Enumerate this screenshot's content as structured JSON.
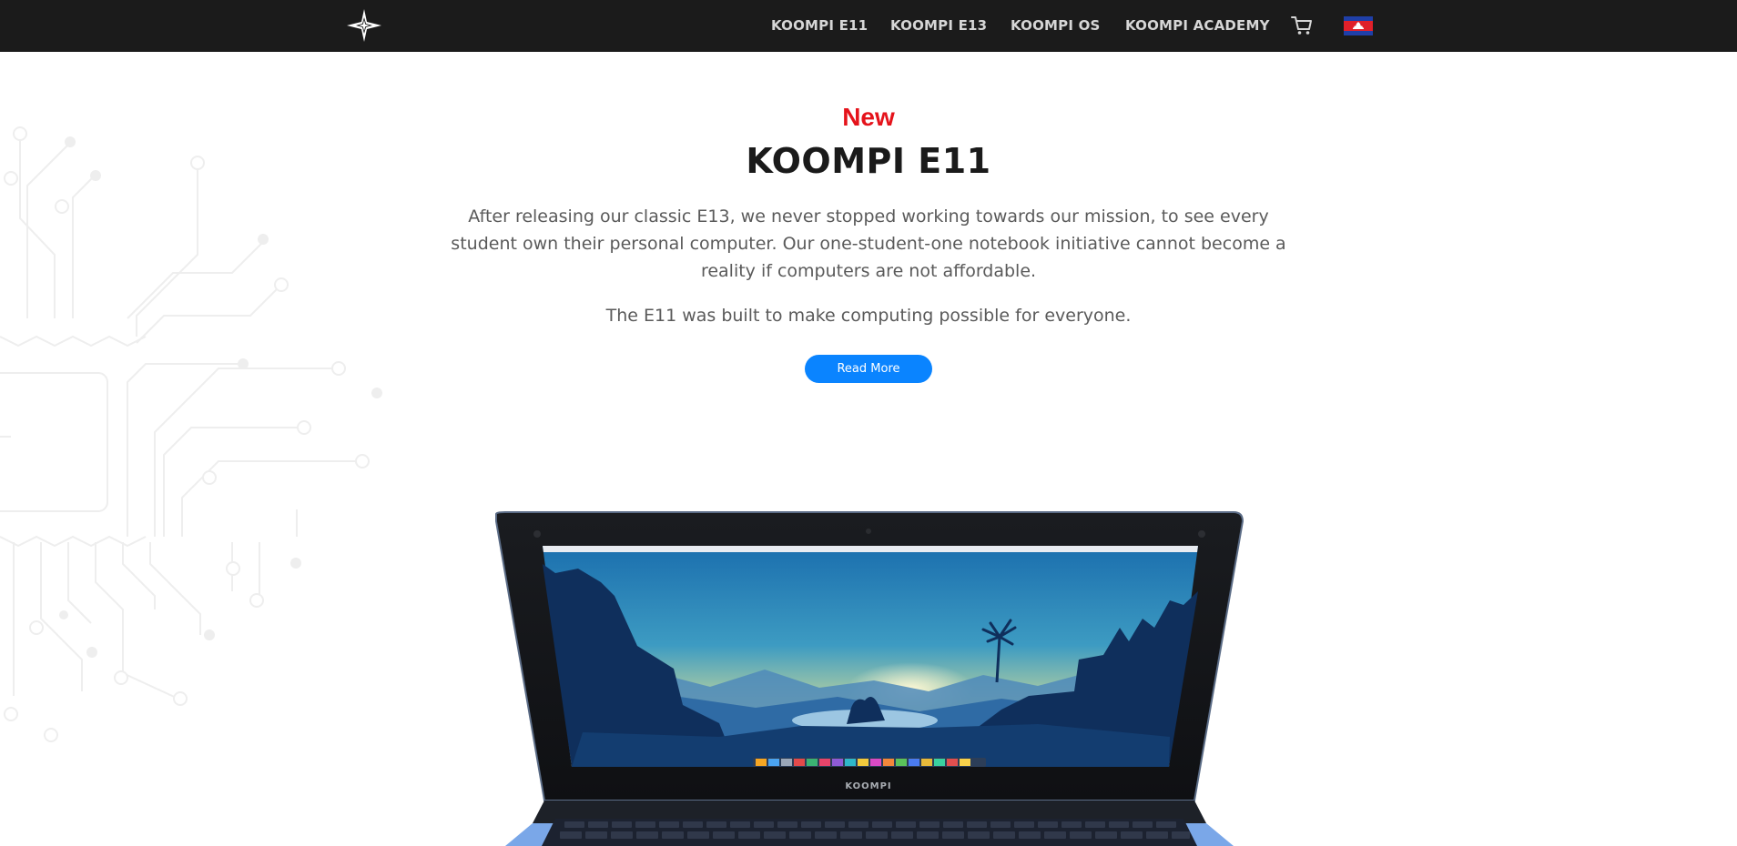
{
  "navbar": {
    "logo": "koompi-star-logo",
    "links": [
      {
        "label": "KOOMPI E11"
      },
      {
        "label": "KOOMPI E13"
      },
      {
        "label": "KOOMPI OS"
      },
      {
        "label": "KOOMPI ACADEMY"
      }
    ],
    "cart_icon": "cart-icon",
    "language_flag": "cambodia-flag-icon",
    "background_color": "#1b1b1b"
  },
  "hero": {
    "tag": "New",
    "title": "KOOMPI E11",
    "paragraph_1": "After releasing our classic E13, we never stopped working towards our mission, to see every student own their personal computer. Our one-student-one notebook initiative cannot become a reality if computers are not affordable.",
    "paragraph_2": "The E11 was built to make computing possible for everyone.",
    "button_label": "Read More",
    "accent_color": "#e5131b",
    "button_color": "#0a84ff"
  },
  "laptop": {
    "bezel_brand": "KOOMPI"
  }
}
